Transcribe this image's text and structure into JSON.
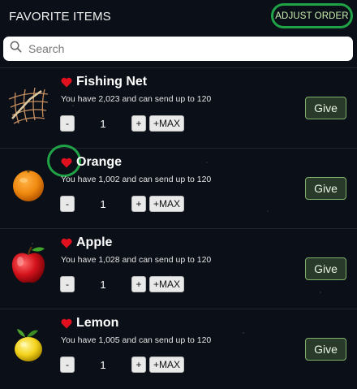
{
  "header": {
    "title": "FAVORITE ITEMS",
    "adjust_order_label": "ADJUST ORDER"
  },
  "search": {
    "placeholder": "Search",
    "value": ""
  },
  "items": [
    {
      "name": "Fishing Net",
      "info": "You have 2,023 and can send up to 120",
      "qty": "1",
      "minus": "-",
      "plus": "+",
      "max": "+MAX",
      "give": "Give",
      "icon": "fishing-net-icon"
    },
    {
      "name": "Orange",
      "info": "You have 1,002 and can send up to 120",
      "qty": "1",
      "minus": "-",
      "plus": "+",
      "max": "+MAX",
      "give": "Give",
      "icon": "orange-icon"
    },
    {
      "name": "Apple",
      "info": "You have 1,028 and can send up to 120",
      "qty": "1",
      "minus": "-",
      "plus": "+",
      "max": "+MAX",
      "give": "Give",
      "icon": "apple-icon"
    },
    {
      "name": "Lemon",
      "info": "You have 1,005 and can send up to 120",
      "qty": "1",
      "minus": "-",
      "plus": "+",
      "max": "+MAX",
      "give": "Give",
      "icon": "lemon-icon"
    }
  ],
  "colors": {
    "background": "#0b0f17",
    "heart": "#e0101e",
    "highlight": "#20a347",
    "give_border": "#7fb06a"
  }
}
